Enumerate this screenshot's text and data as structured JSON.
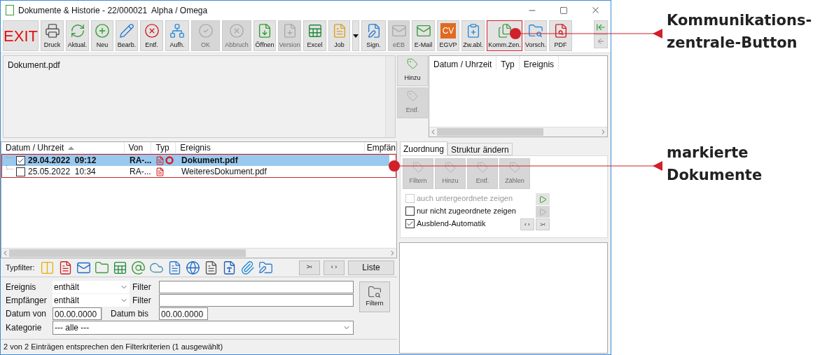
{
  "window": {
    "title": "Dokumente & Historie - 22/000021  Alpha / Omega"
  },
  "toolbar": [
    {
      "label": "EXIT",
      "kind": "exit",
      "disabled": false,
      "marked": false
    },
    {
      "label": "Druck",
      "kind": "button",
      "disabled": false,
      "marked": false
    },
    {
      "label": "Aktual.",
      "kind": "button",
      "disabled": false,
      "marked": false
    },
    {
      "label": "Neu",
      "kind": "button",
      "disabled": false,
      "marked": false
    },
    {
      "label": "Bearb.",
      "kind": "button",
      "disabled": false,
      "marked": false
    },
    {
      "label": "Entf.",
      "kind": "button",
      "disabled": false,
      "marked": false
    },
    {
      "label": "Aufh.",
      "kind": "button",
      "disabled": false,
      "marked": false
    },
    {
      "label": "OK",
      "kind": "button",
      "disabled": true,
      "marked": false
    },
    {
      "label": "Abbruch",
      "kind": "button",
      "disabled": true,
      "marked": false
    },
    {
      "label": "Öffnen",
      "kind": "button",
      "disabled": false,
      "marked": false
    },
    {
      "label": "Version",
      "kind": "button",
      "disabled": true,
      "marked": false
    },
    {
      "label": "Excel",
      "kind": "button",
      "disabled": false,
      "marked": false
    },
    {
      "label": "Job",
      "kind": "button",
      "disabled": false,
      "marked": false
    },
    {
      "kind": "dropdown",
      "disabled": false,
      "marked": false
    },
    {
      "label": "Sign.",
      "kind": "button",
      "disabled": false,
      "marked": false
    },
    {
      "label": "eEB",
      "kind": "button",
      "disabled": true,
      "marked": false
    },
    {
      "label": "E-Mail",
      "kind": "button",
      "disabled": false,
      "marked": false
    },
    {
      "label": "EGVP",
      "kind": "button",
      "disabled": false,
      "marked": false,
      "icon_text": "CV"
    },
    {
      "label": "Zw.abl.",
      "kind": "button",
      "disabled": false,
      "marked": false
    },
    {
      "label": "Komm.Zen.",
      "kind": "button",
      "disabled": false,
      "marked": true
    },
    {
      "label": "Vorsch.",
      "kind": "button",
      "disabled": false,
      "marked": false
    },
    {
      "label": "PDF",
      "kind": "button",
      "disabled": false,
      "marked": false
    }
  ],
  "attachments": {
    "text": "Dokument.pdf"
  },
  "table": {
    "columns": [
      {
        "label": "Datum / Uhrzeit",
        "sorted": true
      },
      {
        "label": "Von",
        "sorted": false
      },
      {
        "label": "Typ",
        "sorted": false
      },
      {
        "label": "Ereignis",
        "sorted": false
      },
      {
        "label": "Empfän",
        "sorted": false
      }
    ],
    "marked": true,
    "rows": [
      {
        "date": "29.04.2022  09:12",
        "from": "RA-...",
        "event": "Dokument.pdf",
        "checked": true,
        "selected": true,
        "seal": true
      },
      {
        "date": "25.05.2022  10:34",
        "from": "RA-...",
        "event": "WeiteresDokument.pdf",
        "checked": false,
        "selected": false,
        "seal": false
      }
    ]
  },
  "typfilter": {
    "label": "Typfilter:",
    "buttons": [
      ">‹",
      "‹ ›",
      "Liste"
    ]
  },
  "filter": {
    "rows": [
      {
        "label": "Ereignis",
        "mode": "enthält",
        "filter_label": "Filter"
      },
      {
        "label": "Empfänger",
        "mode": "enthält",
        "filter_label": "Filter"
      }
    ],
    "date_from": {
      "label": "Datum von",
      "value": "00.00.0000"
    },
    "date_to": {
      "label": "Datum bis",
      "value": "00.00.0000"
    },
    "category": {
      "label": "Kategorie",
      "value": "--- alle ---"
    },
    "button": "Filtern"
  },
  "status_bar": "2 von 2 Einträgen entsprechen den Filterkriterien (1 ausgewählt)",
  "side_buttons": [
    {
      "label": "Hinzu",
      "disabled": false
    },
    {
      "label": "Entf.",
      "disabled": true
    }
  ],
  "linked_list": {
    "columns": [
      "Datum / Uhrzeit",
      "Typ",
      "Ereignis"
    ]
  },
  "tabs": [
    {
      "label": "Zuordnung",
      "selected": true
    },
    {
      "label": "Struktur ändern",
      "selected": false
    }
  ],
  "assign_buttons": [
    {
      "label": "Filtern",
      "disabled": true
    },
    {
      "label": "Hinzu",
      "disabled": true
    },
    {
      "label": "Entf.",
      "disabled": true
    },
    {
      "label": "Zählen",
      "disabled": true
    }
  ],
  "options": [
    {
      "label": "auch untergeordnete zeigen",
      "checked": false,
      "disabled": true
    },
    {
      "label": "nur nicht zugeordnete zeigen",
      "checked": false,
      "disabled": false
    },
    {
      "label": "Ausblend-Automatik",
      "checked": true,
      "disabled": false
    }
  ],
  "option_buttons": [
    "‹ ›",
    ">‹"
  ],
  "annotations": [
    {
      "lines": [
        "Kommunikations-",
        "zentrale-Button"
      ]
    },
    {
      "lines": [
        "markierte",
        "Dokumente"
      ]
    }
  ]
}
